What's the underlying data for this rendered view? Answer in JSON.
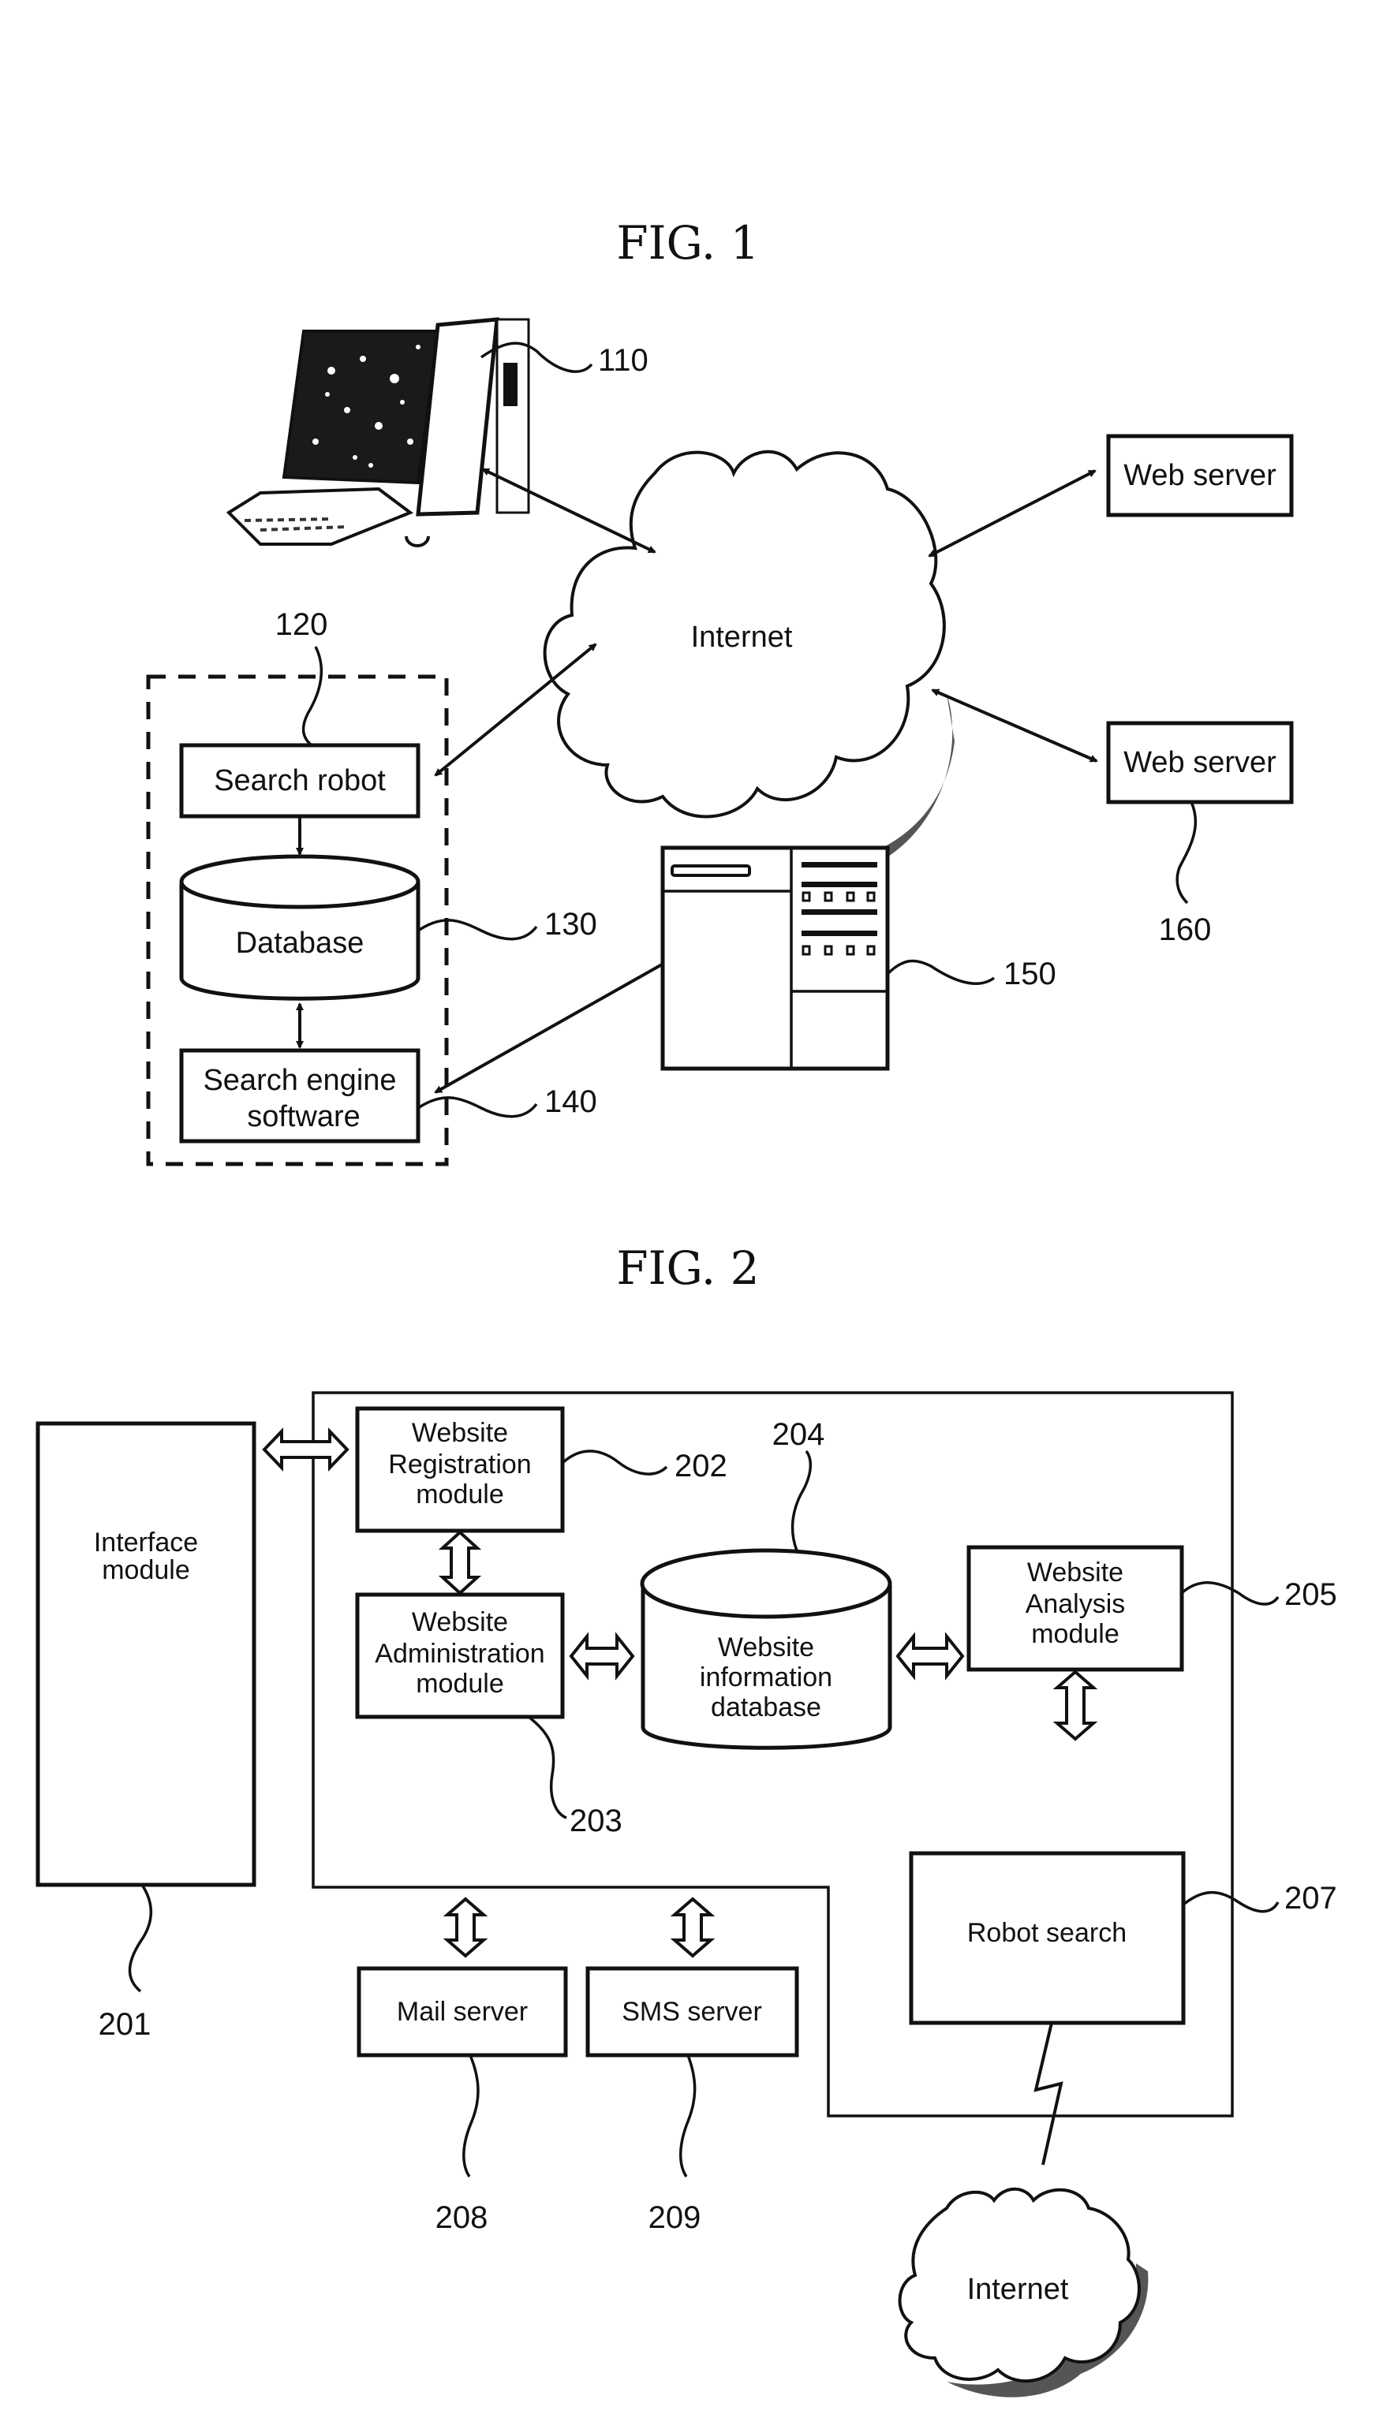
{
  "fig1": {
    "title": "FIG. 1",
    "nodes": {
      "user_computer": {
        "ref": "110",
        "icon": "desktop-computer-icon"
      },
      "internet": {
        "label": "Internet"
      },
      "search_robot": {
        "label": "Search robot",
        "ref": "120"
      },
      "database": {
        "label": "Database",
        "ref": "130"
      },
      "search_engine_software": {
        "label_line1": "Search engine",
        "label_line2": "software",
        "ref": "140"
      },
      "search_server": {
        "ref": "150",
        "icon": "server-rack-icon"
      },
      "web_server_1": {
        "label": "Web server"
      },
      "web_server_2": {
        "label": "Web server",
        "ref": "160"
      }
    },
    "edges": [
      [
        "user_computer",
        "internet",
        "bidirectional"
      ],
      [
        "search_robot",
        "internet",
        "bidirectional"
      ],
      [
        "internet",
        "web_server_1",
        "bidirectional"
      ],
      [
        "internet",
        "web_server_2",
        "bidirectional"
      ],
      [
        "search_robot",
        "database",
        "directed"
      ],
      [
        "database",
        "search_engine_software",
        "bidirectional"
      ],
      [
        "search_engine_software",
        "search_server",
        "bidirectional"
      ]
    ]
  },
  "fig2": {
    "title": "FIG. 2",
    "nodes": {
      "interface_module": {
        "label_line1": "Interface",
        "label_line2": "module",
        "ref": "201"
      },
      "registration_module": {
        "label_line1": "Website",
        "label_line2": "Registration",
        "label_line3": "module",
        "ref": "202"
      },
      "administration_module": {
        "label_line1": "Website",
        "label_line2": "Administration",
        "label_line3": "module",
        "ref": "203"
      },
      "info_database": {
        "label_line1": "Website",
        "label_line2": "information",
        "label_line3": "database",
        "ref": "204"
      },
      "analysis_module": {
        "label_line1": "Website",
        "label_line2": "Analysis",
        "label_line3": "module",
        "ref": "205"
      },
      "robot_search": {
        "label": "Robot search",
        "ref": "207"
      },
      "mail_server": {
        "label": "Mail server",
        "ref": "208"
      },
      "sms_server": {
        "label": "SMS server",
        "ref": "209"
      },
      "internet": {
        "label": "Internet"
      }
    },
    "edges": [
      [
        "interface_module",
        "registration_module",
        "bidirectional"
      ],
      [
        "registration_module",
        "administration_module",
        "bidirectional"
      ],
      [
        "administration_module",
        "info_database",
        "bidirectional"
      ],
      [
        "info_database",
        "analysis_module",
        "bidirectional"
      ],
      [
        "analysis_module",
        "robot_search",
        "bidirectional"
      ],
      [
        "system",
        "mail_server",
        "bidirectional"
      ],
      [
        "system",
        "sms_server",
        "bidirectional"
      ],
      [
        "robot_search",
        "internet",
        "wireless"
      ]
    ]
  }
}
